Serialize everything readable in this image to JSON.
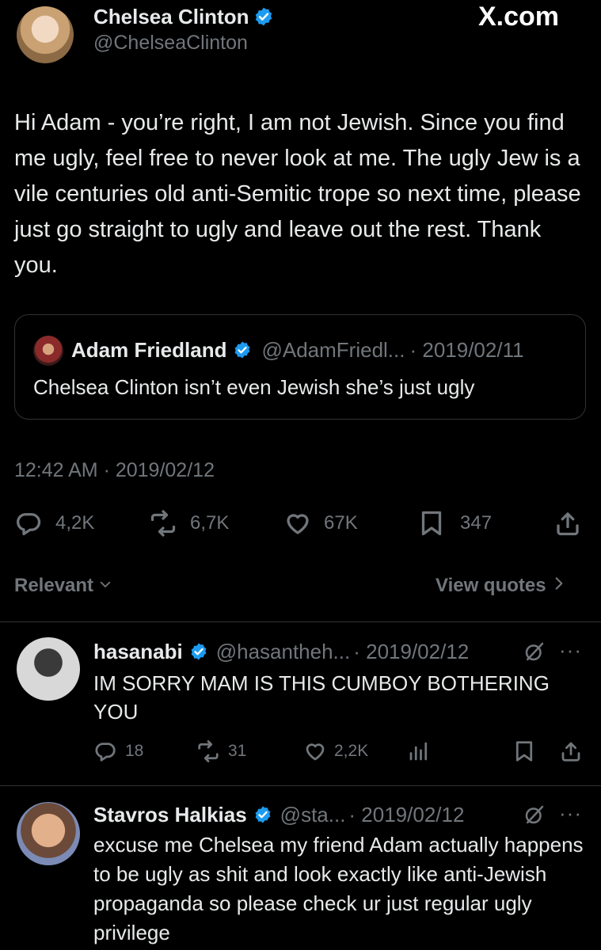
{
  "main_tweet": {
    "author_name": "Chelsea Clinton",
    "author_handle": "@ChelseaClinton",
    "watermark": "X.com",
    "text": "Hi Adam - you’re right, I am not Jewish. Since you find me ugly, feel free to never look at me. The ugly Jew is a vile centuries old anti-Semitic trope so next time, please just go straight to ugly and leave out the rest. Thank you.",
    "timestamp": "12:42 AM · 2019/02/12",
    "stats": {
      "replies": "4,2K",
      "reposts": "6,7K",
      "likes": "67K",
      "bookmarks": "347"
    }
  },
  "quoted_tweet": {
    "author_name": "Adam Friedland",
    "author_handle": "@AdamFriedl...",
    "date": "· 2019/02/11",
    "text": "Chelsea Clinton isn’t even Jewish she’s just ugly"
  },
  "sort_bar": {
    "sort_label": "Relevant",
    "view_quotes_label": "View quotes"
  },
  "replies": [
    {
      "author_name": "hasanabi",
      "author_handle": "@hasantheh...",
      "date": "· 2019/02/12",
      "text": "IM SORRY MAM IS THIS CUMBOY BOTHERING YOU",
      "stats": {
        "replies": "18",
        "reposts": "31",
        "likes": "2,2K"
      }
    },
    {
      "author_name": "Stavros Halkias",
      "author_handle": "@sta...",
      "date": "· 2019/02/12",
      "text": "excuse me Chelsea my friend Adam actually happens to be ugly as shit and look exactly like anti-Jewish propaganda so please check ur just regular ugly privilege"
    }
  ],
  "colors": {
    "background": "#000000",
    "text": "#e7e9ea",
    "muted": "#71767b",
    "verified": "#1d9bf0",
    "divider": "#2f3336"
  }
}
